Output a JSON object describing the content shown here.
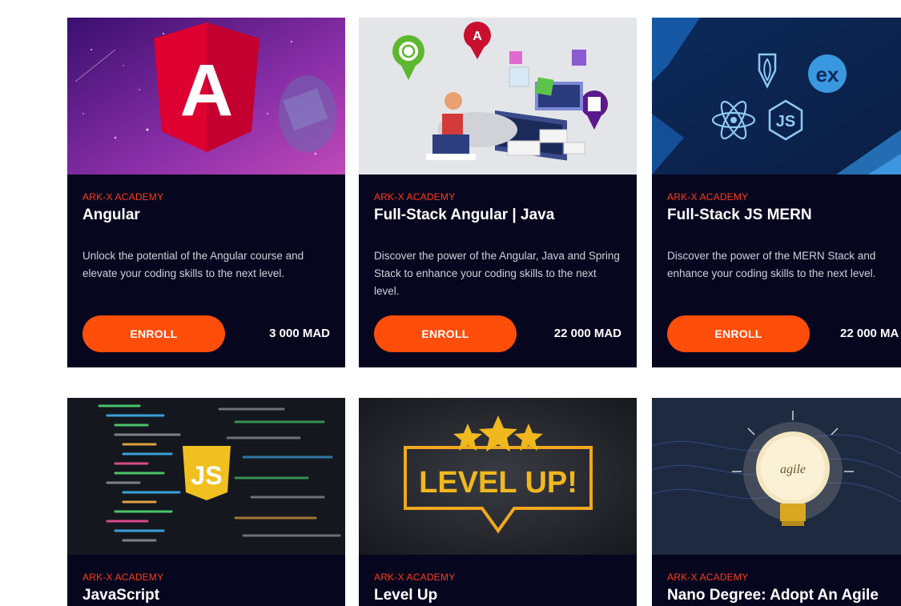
{
  "courses": [
    {
      "provider": "ARK-X ACADEMY",
      "title": "Angular",
      "description": "Unlock the potential of the Angular course and elevate your coding skills to the next level.",
      "button": "ENROLL",
      "price": "3 000 MAD",
      "image": "angular-logo-space-banner"
    },
    {
      "provider": "ARK-X ACADEMY",
      "title": "Full-Stack Angular | Java",
      "description": "Discover the power of the Angular, Java and Spring Stack to enhance your coding skills to the next level.",
      "button": "ENROLL",
      "price": "22 000 MAD",
      "image": "developer-at-desk-illustration"
    },
    {
      "provider": "ARK-X ACADEMY",
      "title": "Full-Stack JS MERN",
      "description": "Discover the power of the MERN Stack and enhance your coding skills to the next level.",
      "button": "ENROLL",
      "price": "22 000 MA",
      "image": "mern-stack-icons"
    },
    {
      "provider": "ARK-X ACADEMY",
      "title": "JavaScript",
      "image": "javascript-code-editor"
    },
    {
      "provider": "ARK-X ACADEMY",
      "title": "Level Up",
      "image_text": "LEVEL UP!",
      "image": "level-up-stars-badge"
    },
    {
      "provider": "ARK-X ACADEMY",
      "title": "Nano Degree: Adopt An Agile",
      "image_text": "agile",
      "image": "agile-lightbulb"
    }
  ],
  "colors": {
    "card_background": "#06061f",
    "provider": "#ff3d1a",
    "button": "#ff4d0a",
    "page_background": "#ffffff"
  }
}
